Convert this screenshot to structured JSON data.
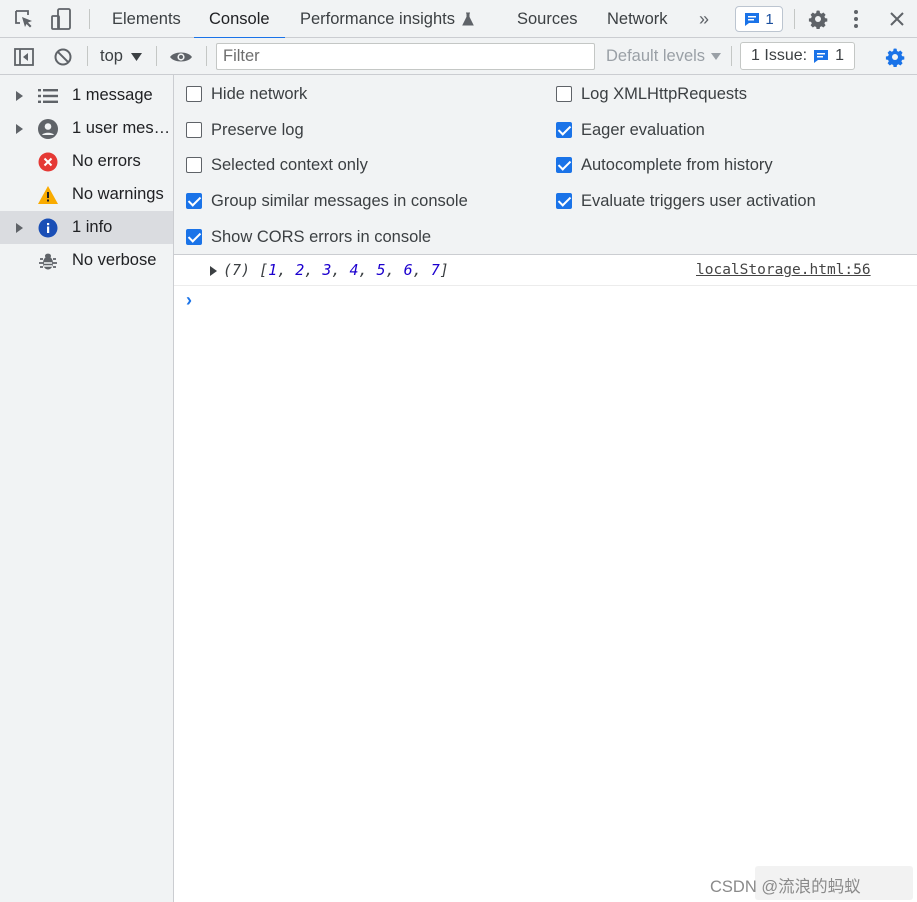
{
  "tabs": [
    {
      "label": "Elements",
      "active": false
    },
    {
      "label": "Console",
      "active": true
    },
    {
      "label": "Performance insights",
      "active": false
    },
    {
      "label": "Sources",
      "active": false
    },
    {
      "label": "Network",
      "active": false
    }
  ],
  "tabbar": {
    "more_tabs_icon": "double-chevron-icon",
    "messages_count": "1"
  },
  "toolbar": {
    "context_label": "top",
    "filter_placeholder": "Filter",
    "levels_label": "Default levels",
    "issues_label": "1 Issue:",
    "issues_count": "1"
  },
  "sidebar": {
    "items": [
      {
        "label": "1 message",
        "icon": "list-icon",
        "expandable": true,
        "selected": false
      },
      {
        "label": "1 user mess…",
        "icon": "user-icon",
        "expandable": true,
        "selected": false
      },
      {
        "label": "No errors",
        "icon": "error-icon",
        "expandable": false,
        "selected": false
      },
      {
        "label": "No warnings",
        "icon": "warning-icon",
        "expandable": false,
        "selected": false
      },
      {
        "label": "1 info",
        "icon": "info-icon",
        "expandable": true,
        "selected": true
      },
      {
        "label": "No verbose",
        "icon": "bug-icon",
        "expandable": false,
        "selected": false
      }
    ]
  },
  "settings": {
    "left": [
      {
        "label": "Hide network",
        "checked": false
      },
      {
        "label": "Preserve log",
        "checked": false
      },
      {
        "label": "Selected context only",
        "checked": false
      },
      {
        "label": "Group similar messages in console",
        "checked": true
      },
      {
        "label": "Show CORS errors in console",
        "checked": true
      }
    ],
    "right": [
      {
        "label": "Log XMLHttpRequests",
        "checked": false
      },
      {
        "label": "Eager evaluation",
        "checked": true
      },
      {
        "label": "Autocomplete from history",
        "checked": true
      },
      {
        "label": "Evaluate triggers user activation",
        "checked": true
      }
    ]
  },
  "console": {
    "entry_prefix": "(7) [",
    "entry_values": [
      "1",
      "2",
      "3",
      "4",
      "5",
      "6",
      "7"
    ],
    "entry_suffix": "]",
    "source_link": "localStorage.html:56",
    "prompt_symbol": "›"
  },
  "watermark": "CSDN @流浪的蚂蚁"
}
